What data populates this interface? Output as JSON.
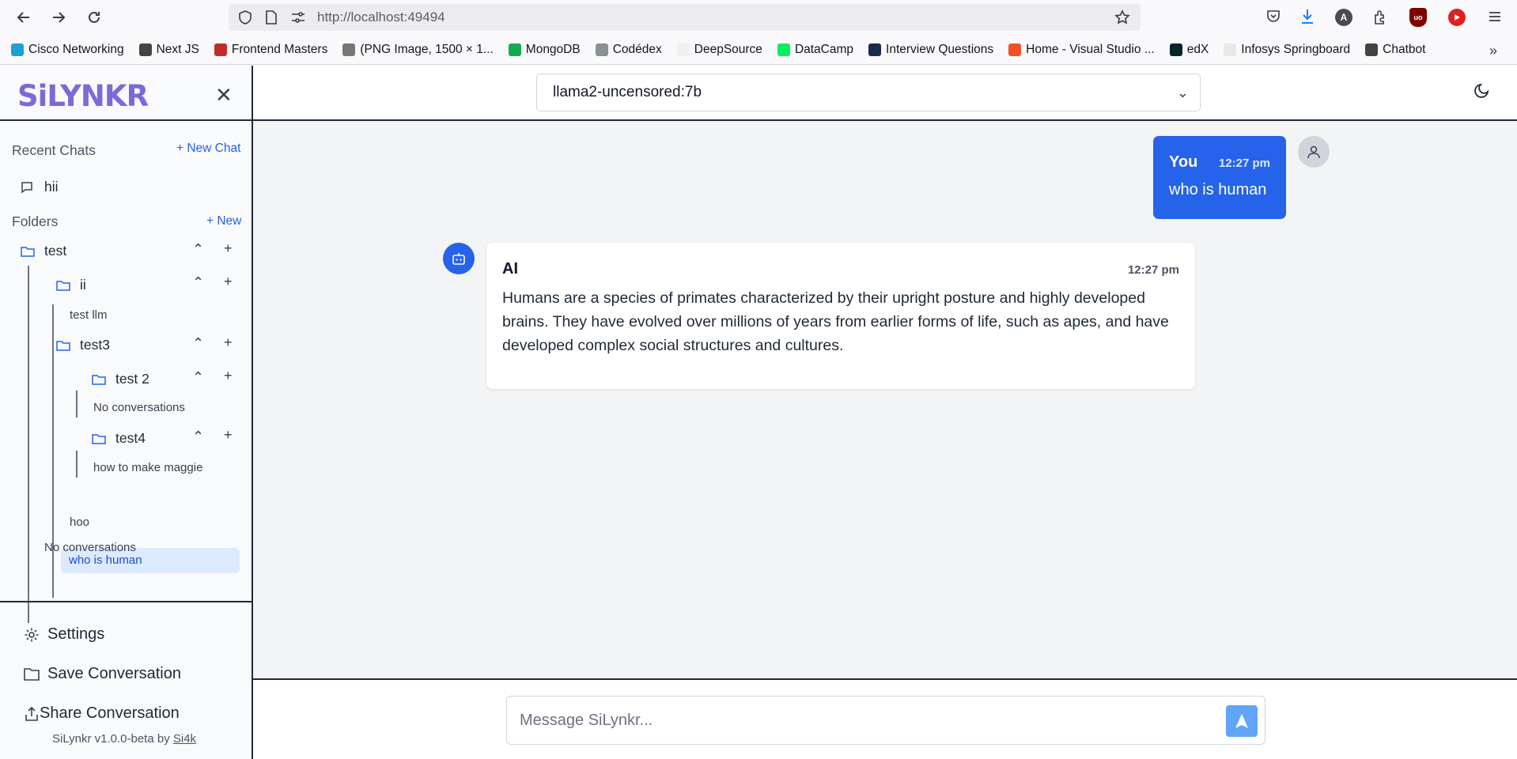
{
  "browser": {
    "url_host": "http://localhost:",
    "url_port": "49494",
    "bookmarks": [
      {
        "label": "Cisco Networking",
        "color": "#1ba0d7"
      },
      {
        "label": "Next JS",
        "color": "#444444"
      },
      {
        "label": "Frontend Masters",
        "color": "#c02d28"
      },
      {
        "label": "(PNG Image, 1500 × 1...",
        "color": "#777777"
      },
      {
        "label": "MongoDB",
        "color": "#13aa52"
      },
      {
        "label": "Codédex",
        "color": "#8a8f98"
      },
      {
        "label": "DeepSource",
        "color": "#f0f0f0"
      },
      {
        "label": "DataCamp",
        "color": "#03ef62"
      },
      {
        "label": "Interview Questions",
        "color": "#1b2a4a"
      },
      {
        "label": "Home - Visual Studio ...",
        "color": "#f25022"
      },
      {
        "label": "edX",
        "color": "#02262b"
      },
      {
        "label": "Infosys Springboard",
        "color": "#e8e8e8"
      },
      {
        "label": "Chatbot",
        "color": "#444444"
      }
    ]
  },
  "sidebar": {
    "logo": "SiLYNKR",
    "recent_chats_label": "Recent Chats",
    "new_chat_label": "+ New Chat",
    "recent_chats": [
      "hii"
    ],
    "folders_label": "Folders",
    "new_folder_label": "+ New",
    "folder_test": "test",
    "folder_ii": "ii",
    "conv_test_llm": "test llm",
    "folder_test3": "test3",
    "folder_test2": "test 2",
    "no_conversations_1": "No conversations",
    "folder_test4": "test4",
    "conv_maggie": "how to make maggie",
    "conv_human": "who is human",
    "conv_hoo": "hoo",
    "no_conversations_2": "No conversations",
    "settings_label": "Settings",
    "save_label": "Save Conversation",
    "share_label": "Share Conversation",
    "version_text": "SiLynkr v1.0.0-beta by ",
    "author": "Si4k"
  },
  "header": {
    "model": "llama2-uncensored:7b"
  },
  "messages": {
    "user": {
      "name": "You",
      "time": "12:27 pm",
      "text": "who is human"
    },
    "ai": {
      "name": "AI",
      "time": "12:27 pm",
      "text": "Humans are a species of primates characterized by their upright posture and highly developed brains. They have evolved over millions of years from earlier forms of life, such as apes, and have developed complex social structures and cultures."
    }
  },
  "composer": {
    "placeholder": "Message SiLynkr..."
  },
  "colors": {
    "accent": "#2563eb",
    "active_bg": "#dbeafe"
  }
}
